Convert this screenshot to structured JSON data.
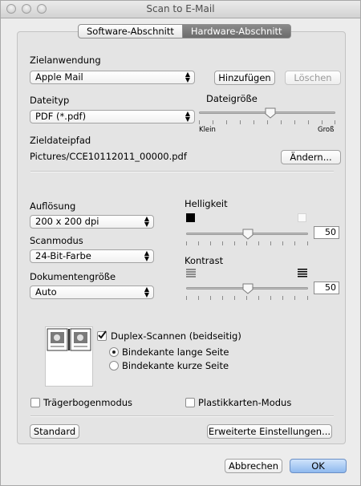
{
  "window": {
    "title": "Scan to E-Mail"
  },
  "tabs": [
    {
      "label": "Software-Abschnitt",
      "selected": false
    },
    {
      "label": "Hardware-Abschnitt",
      "selected": true
    }
  ],
  "target": {
    "label": "Zielanwendung",
    "value": "Apple Mail",
    "add_label": "Hinzufügen",
    "delete_label": "Löschen"
  },
  "filetype": {
    "label": "Dateityp",
    "value": "PDF (*.pdf)"
  },
  "filesize": {
    "label": "Dateigröße",
    "min_label": "Klein",
    "max_label": "Groß",
    "value": 0.5
  },
  "path": {
    "label": "Zieldateipfad",
    "value": "Pictures/CCE10112011_00000.pdf",
    "change_label": "Ändern..."
  },
  "resolution": {
    "label": "Auflösung",
    "value": "200 x 200 dpi"
  },
  "scanmode": {
    "label": "Scanmodus",
    "value": "24-Bit-Farbe"
  },
  "docsize": {
    "label": "Dokumentengröße",
    "value": "Auto"
  },
  "brightness": {
    "label": "Helligkeit",
    "value": "50"
  },
  "contrast": {
    "label": "Kontrast",
    "value": "50"
  },
  "duplex": {
    "label": "Duplex-Scannen (beidseitig)",
    "checked": true,
    "options": [
      {
        "label": "Bindekante lange Seite",
        "selected": true
      },
      {
        "label": "Bindekante kurze Seite",
        "selected": false
      }
    ]
  },
  "carrier": {
    "label": "Trägerbogenmodus",
    "checked": false
  },
  "plastic": {
    "label": "Plastikkarten-Modus",
    "checked": false
  },
  "buttons": {
    "standard": "Standard",
    "advanced": "Erweiterte Einstellungen...",
    "cancel": "Abbrechen",
    "ok": "OK"
  },
  "colors": {
    "accent": "#8fb9ee",
    "selected_tab": "#6c6c6c"
  }
}
